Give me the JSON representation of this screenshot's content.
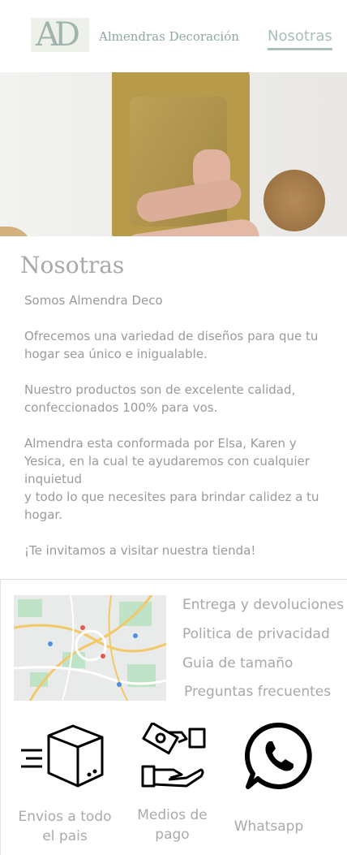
{
  "header": {
    "logo_text": "AD",
    "brand": "Almendras Decoración",
    "nav_link": "Nosotras"
  },
  "about": {
    "title": "Nosotras",
    "paragraphs": [
      "Somos Almendra Deco",
      "Ofrecemos una variedad de diseños para que tu hogar sea único e inigualable.",
      "Nuestro productos son de excelente calidad, confeccionados 100% para vos.",
      "Almendra esta conformada por Elsa, Karen y Yesica, en la cual te ayudaremos con cualquier inquietud",
      "y todo lo que necesites para brindar calidez a tu hogar.",
      "¡Te invitamos a visitar nuestra tienda!"
    ]
  },
  "footer": {
    "links": [
      "Entrega y devoluciones",
      "Politica de privacidad",
      "Guia de tamaño",
      "Preguntas frecuentes"
    ],
    "features": [
      {
        "label": "Envios a todo el pais",
        "icon": "shipping-box-icon"
      },
      {
        "label": "Medios de pago",
        "icon": "payment-hands-icon"
      },
      {
        "label": "Whatsapp",
        "icon": "whatsapp-icon"
      }
    ]
  },
  "colors": {
    "accent": "#a9bfb8",
    "text_muted": "#9a9a9a"
  }
}
